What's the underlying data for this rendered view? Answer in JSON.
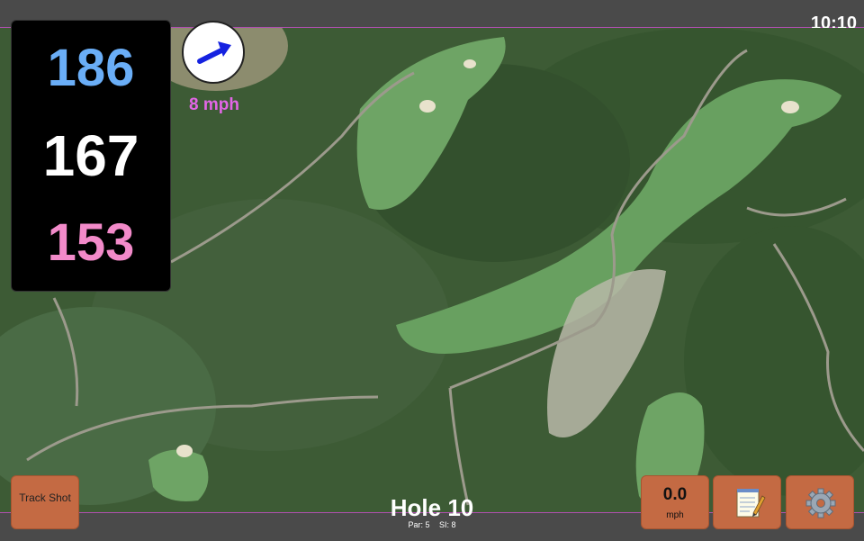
{
  "status": {
    "time": "10:10"
  },
  "distances": {
    "back": "186",
    "middle": "167",
    "front": "153"
  },
  "wind": {
    "speed_label": "8 mph",
    "direction_icon": "wind-arrow-icon"
  },
  "hole": {
    "title": "Hole 10",
    "par": "Par: 5",
    "si": "SI: 8"
  },
  "buttons": {
    "track_shot": "Track Shot",
    "speed_value": "0.0",
    "speed_unit": "mph",
    "notes_icon": "notepad-icon",
    "settings_icon": "gear-icon"
  },
  "colors": {
    "back": "#6aaef7",
    "middle": "#ffffff",
    "front": "#f28ac9",
    "wind_text": "#e266e6",
    "button": "#c46a43",
    "divider": "#b04fb0"
  }
}
